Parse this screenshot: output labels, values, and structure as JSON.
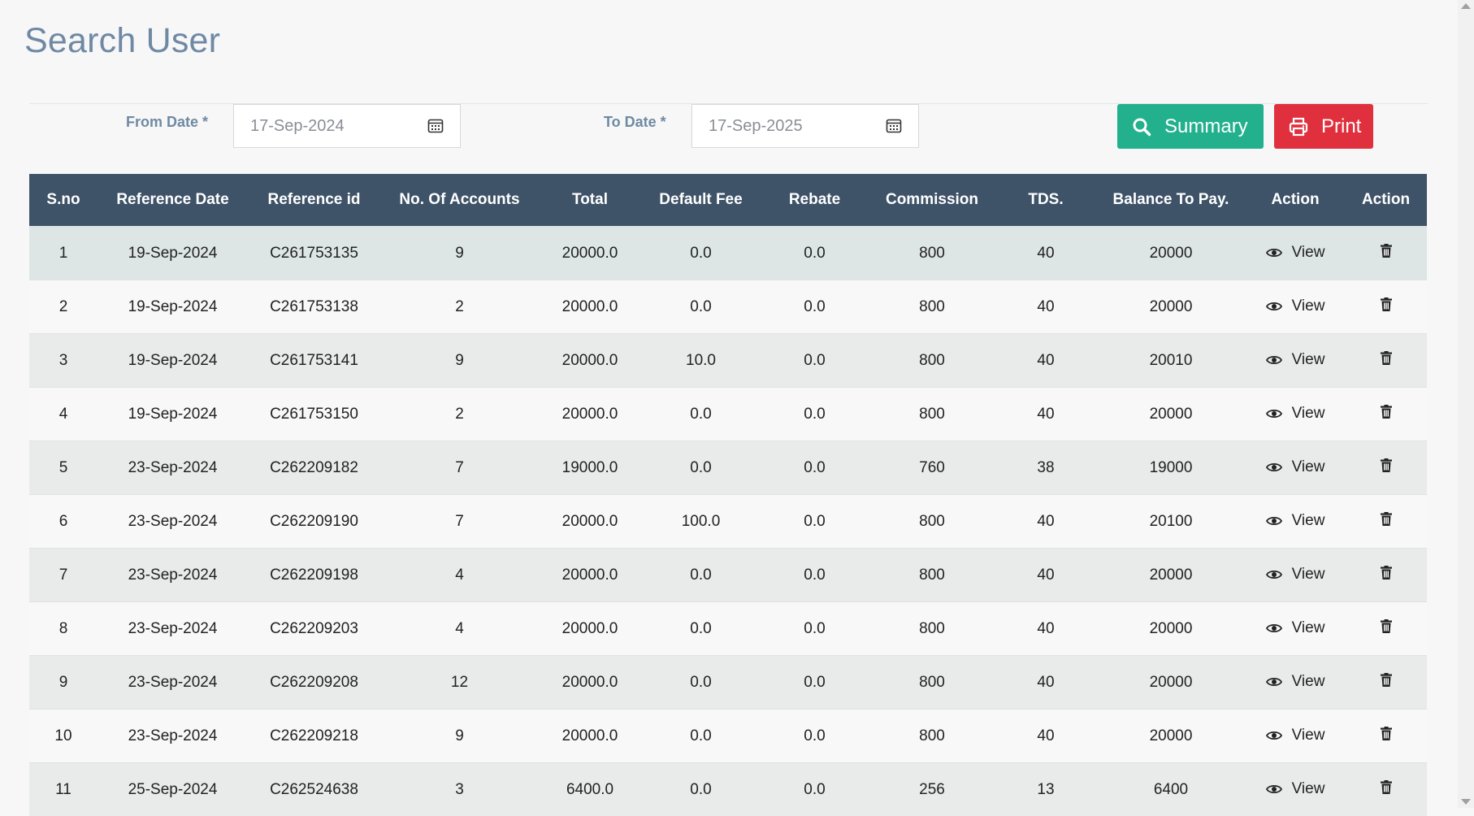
{
  "page": {
    "title": "Search User"
  },
  "filters": {
    "from_label": "From Date *",
    "from_value": "17-Sep-2024",
    "to_label": "To Date *",
    "to_value": "17-Sep-2025"
  },
  "buttons": {
    "summary": "Summary",
    "print": "Print"
  },
  "table": {
    "headers": [
      "S.no",
      "Reference Date",
      "Reference id",
      "No. Of Accounts",
      "Total",
      "Default Fee",
      "Rebate",
      "Commission",
      "TDS.",
      "Balance To Pay.",
      "Action",
      "Action"
    ],
    "view_label": "View",
    "rows": [
      [
        "1",
        "19-Sep-2024",
        "C261753135",
        "9",
        "20000.0",
        "0.0",
        "0.0",
        "800",
        "40",
        "20000"
      ],
      [
        "2",
        "19-Sep-2024",
        "C261753138",
        "2",
        "20000.0",
        "0.0",
        "0.0",
        "800",
        "40",
        "20000"
      ],
      [
        "3",
        "19-Sep-2024",
        "C261753141",
        "9",
        "20000.0",
        "10.0",
        "0.0",
        "800",
        "40",
        "20010"
      ],
      [
        "4",
        "19-Sep-2024",
        "C261753150",
        "2",
        "20000.0",
        "0.0",
        "0.0",
        "800",
        "40",
        "20000"
      ],
      [
        "5",
        "23-Sep-2024",
        "C262209182",
        "7",
        "19000.0",
        "0.0",
        "0.0",
        "760",
        "38",
        "19000"
      ],
      [
        "6",
        "23-Sep-2024",
        "C262209190",
        "7",
        "20000.0",
        "100.0",
        "0.0",
        "800",
        "40",
        "20100"
      ],
      [
        "7",
        "23-Sep-2024",
        "C262209198",
        "4",
        "20000.0",
        "0.0",
        "0.0",
        "800",
        "40",
        "20000"
      ],
      [
        "8",
        "23-Sep-2024",
        "C262209203",
        "4",
        "20000.0",
        "0.0",
        "0.0",
        "800",
        "40",
        "20000"
      ],
      [
        "9",
        "23-Sep-2024",
        "C262209208",
        "12",
        "20000.0",
        "0.0",
        "0.0",
        "800",
        "40",
        "20000"
      ],
      [
        "10",
        "23-Sep-2024",
        "C262209218",
        "9",
        "20000.0",
        "0.0",
        "0.0",
        "800",
        "40",
        "20000"
      ],
      [
        "11",
        "25-Sep-2024",
        "C262524638",
        "3",
        "6400.0",
        "0.0",
        "0.0",
        "256",
        "13",
        "6400"
      ]
    ]
  },
  "icons": {
    "calendar": "calendar-icon",
    "search": "search-icon",
    "print": "printer-icon",
    "view": "eye-icon",
    "delete": "trash-icon"
  },
  "colors": {
    "title": "#6f89a5",
    "header_bg": "#3e5368",
    "summary_button": "#22b08d",
    "print_button": "#e0303e"
  }
}
